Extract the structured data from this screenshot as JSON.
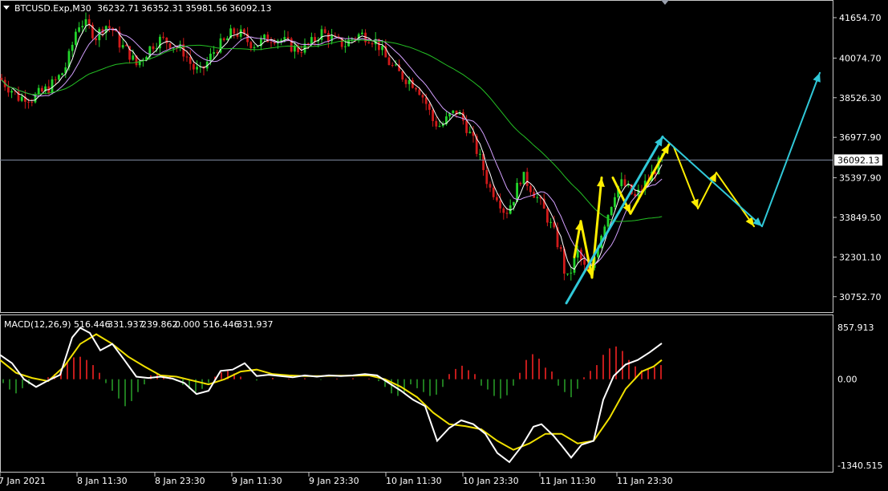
{
  "window": {
    "symbol_label": "BTCUSD.Exp,M30",
    "ohlc": {
      "open": "36232.71",
      "high": "36352.31",
      "low": "35981.56",
      "close": "36092.13"
    }
  },
  "indicator": {
    "title": "MACD(12,26,9)",
    "values": [
      "516.446",
      "331.937",
      "239.862",
      "0.000",
      "516.446",
      "331.937"
    ]
  },
  "colors": {
    "background": "#000000",
    "bull": "#22d32b",
    "bear": "#d01a1a",
    "ma_fast": "#ffffff",
    "ma_mid": "#d4a0ff",
    "ma_slow": "#24c024",
    "macd_line": "#ffffff",
    "signal_line": "#f0e000",
    "hist_pos": "#c21b1b",
    "hist_neg": "#1f7a1f",
    "arrow_yellow": "#ffee00",
    "arrow_cyan": "#30c8d8",
    "grid_line": "#7f8aa0"
  },
  "chart_data": [
    {
      "type": "candlestick",
      "title": "BTCUSD.Exp,M30",
      "ylim": [
        30150,
        42250
      ],
      "yticks": [
        "41654.70",
        "40074.70",
        "38526.30",
        "36977.90",
        "35397.90",
        "33849.50",
        "32301.10",
        "30752.70"
      ],
      "xticks": [
        "7 Jan 2021",
        "8 Jan 11:30",
        "8 Jan 23:30",
        "9 Jan 11:30",
        "9 Jan 23:30",
        "10 Jan 11:30",
        "10 Jan 23:30",
        "11 Jan 11:30",
        "11 Jan 23:30"
      ],
      "current_price": "36092.13",
      "price_path": [
        [
          0,
          39300
        ],
        [
          8,
          39000
        ],
        [
          16,
          38800
        ],
        [
          24,
          38500
        ],
        [
          32,
          38600
        ],
        [
          40,
          38500
        ],
        [
          50,
          38700
        ],
        [
          60,
          38900
        ],
        [
          70,
          39200
        ],
        [
          80,
          39600
        ],
        [
          88,
          40300
        ],
        [
          94,
          41100
        ],
        [
          100,
          41500
        ],
        [
          110,
          41300
        ],
        [
          120,
          40900
        ],
        [
          130,
          41400
        ],
        [
          140,
          41200
        ],
        [
          150,
          40600
        ],
        [
          160,
          40300
        ],
        [
          170,
          39800
        ],
        [
          180,
          40200
        ],
        [
          190,
          40600
        ],
        [
          200,
          40800
        ],
        [
          210,
          40700
        ],
        [
          220,
          40500
        ],
        [
          230,
          40300
        ],
        [
          240,
          39700
        ],
        [
          250,
          39500
        ],
        [
          260,
          40000
        ],
        [
          270,
          40500
        ],
        [
          280,
          40700
        ],
        [
          290,
          41100
        ],
        [
          300,
          41000
        ],
        [
          310,
          40700
        ],
        [
          320,
          40600
        ],
        [
          330,
          40800
        ],
        [
          340,
          40900
        ],
        [
          350,
          40800
        ],
        [
          360,
          40600
        ],
        [
          370,
          40400
        ],
        [
          380,
          40500
        ],
        [
          390,
          40700
        ],
        [
          400,
          41100
        ],
        [
          410,
          40900
        ],
        [
          420,
          40700
        ],
        [
          430,
          40600
        ],
        [
          440,
          40900
        ],
        [
          450,
          41000
        ],
        [
          460,
          40900
        ],
        [
          470,
          40700
        ],
        [
          480,
          40100
        ],
        [
          490,
          39700
        ],
        [
          500,
          39400
        ],
        [
          510,
          39200
        ],
        [
          520,
          39000
        ],
        [
          530,
          38400
        ],
        [
          540,
          37600
        ],
        [
          550,
          37400
        ],
        [
          560,
          37800
        ],
        [
          570,
          38000
        ],
        [
          580,
          37500
        ],
        [
          590,
          36800
        ],
        [
          600,
          36000
        ],
        [
          610,
          35000
        ],
        [
          620,
          34700
        ],
        [
          630,
          34000
        ],
        [
          640,
          34600
        ],
        [
          650,
          35500
        ],
        [
          660,
          35100
        ],
        [
          670,
          34600
        ],
        [
          680,
          34000
        ],
        [
          690,
          33300
        ],
        [
          700,
          32400
        ],
        [
          706,
          31300
        ],
        [
          712,
          31800
        ],
        [
          720,
          32500
        ],
        [
          728,
          31900
        ],
        [
          736,
          31600
        ],
        [
          744,
          32700
        ],
        [
          752,
          33500
        ],
        [
          760,
          34200
        ],
        [
          768,
          35000
        ],
        [
          776,
          35200
        ],
        [
          784,
          34900
        ],
        [
          792,
          34600
        ],
        [
          800,
          35000
        ],
        [
          808,
          35300
        ],
        [
          816,
          35700
        ],
        [
          824,
          36100
        ],
        [
          830,
          36300
        ]
      ],
      "series": [
        {
          "name": "",
          "color_key": "ma_fast"
        },
        {
          "name": "",
          "color_key": "ma_mid"
        },
        {
          "name": "",
          "color_key": "ma_slow"
        }
      ]
    },
    {
      "type": "line",
      "title": "MACD(12,26,9)",
      "ylim": [
        -1340.515,
        857.913
      ],
      "yticks": [
        "857.913",
        "0.00",
        "-1340.515"
      ],
      "macd": [
        [
          0,
          380
        ],
        [
          15,
          250
        ],
        [
          30,
          0
        ],
        [
          45,
          -120
        ],
        [
          60,
          -20
        ],
        [
          75,
          70
        ],
        [
          90,
          650
        ],
        [
          100,
          800
        ],
        [
          112,
          720
        ],
        [
          125,
          450
        ],
        [
          140,
          550
        ],
        [
          155,
          300
        ],
        [
          170,
          40
        ],
        [
          185,
          20
        ],
        [
          200,
          40
        ],
        [
          215,
          10
        ],
        [
          230,
          -60
        ],
        [
          245,
          -230
        ],
        [
          260,
          -180
        ],
        [
          275,
          130
        ],
        [
          290,
          150
        ],
        [
          305,
          250
        ],
        [
          320,
          50
        ],
        [
          335,
          70
        ],
        [
          350,
          50
        ],
        [
          365,
          30
        ],
        [
          380,
          60
        ],
        [
          395,
          40
        ],
        [
          410,
          60
        ],
        [
          425,
          50
        ],
        [
          440,
          60
        ],
        [
          455,
          80
        ],
        [
          470,
          60
        ],
        [
          485,
          -60
        ],
        [
          500,
          -180
        ],
        [
          515,
          -320
        ],
        [
          530,
          -420
        ],
        [
          545,
          -960
        ],
        [
          560,
          -760
        ],
        [
          575,
          -640
        ],
        [
          590,
          -700
        ],
        [
          605,
          -850
        ],
        [
          620,
          -1150
        ],
        [
          635,
          -1290
        ],
        [
          650,
          -1050
        ],
        [
          665,
          -740
        ],
        [
          675,
          -700
        ],
        [
          690,
          -880
        ],
        [
          700,
          -1030
        ],
        [
          712,
          -1220
        ],
        [
          725,
          -1020
        ],
        [
          740,
          -960
        ],
        [
          752,
          -320
        ],
        [
          765,
          50
        ],
        [
          780,
          230
        ],
        [
          795,
          300
        ],
        [
          810,
          420
        ],
        [
          825,
          560
        ]
      ],
      "signal": [
        [
          0,
          300
        ],
        [
          20,
          100
        ],
        [
          40,
          20
        ],
        [
          60,
          -30
        ],
        [
          80,
          200
        ],
        [
          100,
          550
        ],
        [
          120,
          700
        ],
        [
          140,
          550
        ],
        [
          160,
          350
        ],
        [
          180,
          200
        ],
        [
          200,
          60
        ],
        [
          220,
          40
        ],
        [
          240,
          -20
        ],
        [
          260,
          -80
        ],
        [
          280,
          0
        ],
        [
          300,
          120
        ],
        [
          320,
          150
        ],
        [
          340,
          80
        ],
        [
          360,
          60
        ],
        [
          380,
          50
        ],
        [
          400,
          50
        ],
        [
          420,
          55
        ],
        [
          440,
          55
        ],
        [
          460,
          60
        ],
        [
          480,
          0
        ],
        [
          500,
          -120
        ],
        [
          520,
          -280
        ],
        [
          540,
          -520
        ],
        [
          560,
          -700
        ],
        [
          580,
          -730
        ],
        [
          600,
          -780
        ],
        [
          620,
          -960
        ],
        [
          640,
          -1100
        ],
        [
          660,
          -1000
        ],
        [
          680,
          -850
        ],
        [
          700,
          -850
        ],
        [
          720,
          -1000
        ],
        [
          740,
          -960
        ],
        [
          760,
          -600
        ],
        [
          780,
          -150
        ],
        [
          800,
          120
        ],
        [
          815,
          200
        ],
        [
          825,
          300
        ]
      ],
      "histogram": [
        [
          4,
          -60
        ],
        [
          12,
          -160
        ],
        [
          20,
          -220
        ],
        [
          28,
          -140
        ],
        [
          36,
          -80
        ],
        [
          60,
          30
        ],
        [
          68,
          80
        ],
        [
          76,
          150
        ],
        [
          84,
          260
        ],
        [
          92,
          340
        ],
        [
          100,
          350
        ],
        [
          108,
          300
        ],
        [
          116,
          220
        ],
        [
          124,
          100
        ],
        [
          132,
          -60
        ],
        [
          140,
          -180
        ],
        [
          148,
          -300
        ],
        [
          156,
          -420
        ],
        [
          164,
          -340
        ],
        [
          172,
          -200
        ],
        [
          180,
          -80
        ],
        [
          188,
          60
        ],
        [
          196,
          90
        ],
        [
          204,
          60
        ],
        [
          212,
          40
        ],
        [
          220,
          -30
        ],
        [
          228,
          -90
        ],
        [
          236,
          -150
        ],
        [
          244,
          -200
        ],
        [
          252,
          -150
        ],
        [
          260,
          -60
        ],
        [
          268,
          40
        ],
        [
          276,
          110
        ],
        [
          284,
          130
        ],
        [
          292,
          90
        ],
        [
          300,
          40
        ],
        [
          320,
          -20
        ],
        [
          340,
          20
        ],
        [
          360,
          10
        ],
        [
          380,
          15
        ],
        [
          400,
          -10
        ],
        [
          420,
          10
        ],
        [
          440,
          15
        ],
        [
          460,
          10
        ],
        [
          472,
          -30
        ],
        [
          480,
          -120
        ],
        [
          488,
          -220
        ],
        [
          496,
          -260
        ],
        [
          504,
          -200
        ],
        [
          512,
          -80
        ],
        [
          520,
          -140
        ],
        [
          528,
          -200
        ],
        [
          536,
          -260
        ],
        [
          544,
          -240
        ],
        [
          552,
          -120
        ],
        [
          560,
          80
        ],
        [
          568,
          160
        ],
        [
          576,
          210
        ],
        [
          584,
          140
        ],
        [
          592,
          80
        ],
        [
          600,
          -100
        ],
        [
          608,
          -160
        ],
        [
          616,
          -260
        ],
        [
          624,
          -300
        ],
        [
          632,
          -250
        ],
        [
          640,
          -100
        ],
        [
          648,
          100
        ],
        [
          656,
          300
        ],
        [
          664,
          390
        ],
        [
          672,
          320
        ],
        [
          680,
          180
        ],
        [
          688,
          120
        ],
        [
          696,
          -100
        ],
        [
          704,
          -200
        ],
        [
          712,
          -280
        ],
        [
          720,
          -150
        ],
        [
          728,
          30
        ],
        [
          736,
          130
        ],
        [
          744,
          220
        ],
        [
          752,
          380
        ],
        [
          760,
          480
        ],
        [
          768,
          510
        ],
        [
          776,
          440
        ],
        [
          784,
          300
        ],
        [
          792,
          200
        ],
        [
          800,
          140
        ],
        [
          808,
          160
        ],
        [
          816,
          190
        ],
        [
          824,
          220
        ]
      ]
    }
  ]
}
